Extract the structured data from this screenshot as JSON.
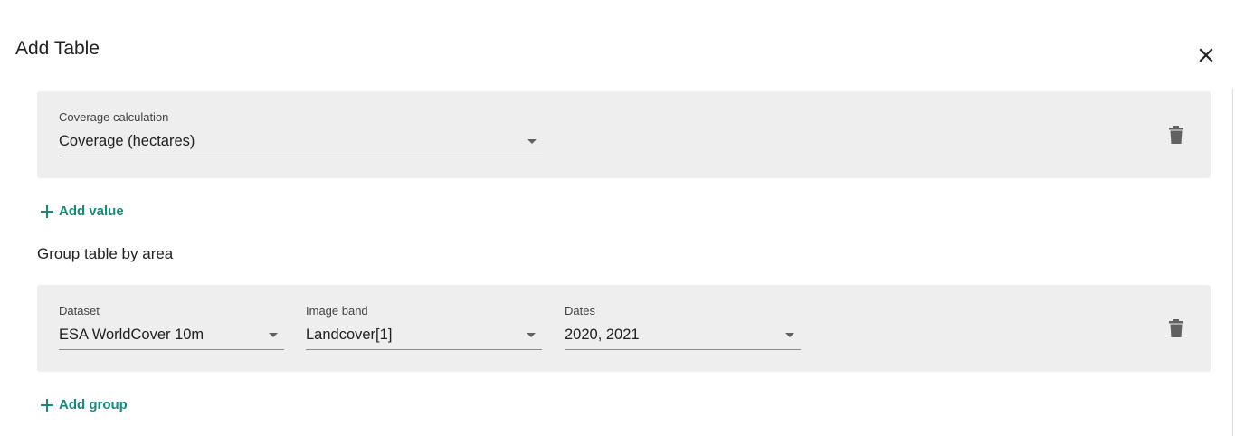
{
  "dialog": {
    "title": "Add Table"
  },
  "values_section": {
    "rows": [
      {
        "coverage_label": "Coverage calculation",
        "coverage_value": "Coverage (hectares)"
      }
    ],
    "add_label": "Add value"
  },
  "group_section": {
    "heading": "Group table by area",
    "rows": [
      {
        "dataset_label": "Dataset",
        "dataset_value": "ESA WorldCover 10m",
        "band_label": "Image band",
        "band_value": "Landcover[1]",
        "dates_label": "Dates",
        "dates_value": "2020, 2021"
      }
    ],
    "add_label": "Add group"
  },
  "colors": {
    "accent": "#138a7b",
    "panel_bg": "#eeeeee",
    "text": "#212121",
    "icon": "#616161"
  },
  "icons": {
    "close": "close-icon",
    "delete": "trash-icon",
    "add": "plus-icon",
    "dropdown": "chevron-down-icon"
  }
}
